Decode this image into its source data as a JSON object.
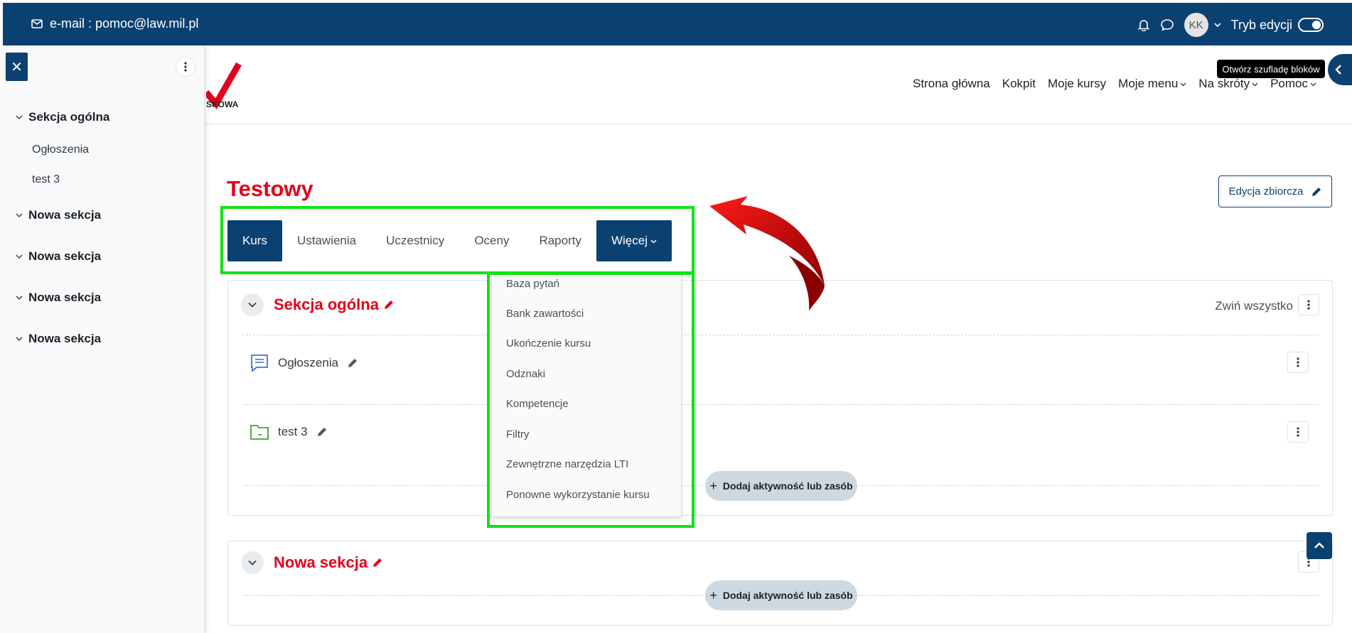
{
  "topbar": {
    "email": "e-mail : pomoc@law.mil.pl",
    "avatar_initials": "KK",
    "edit_mode_label": "Tryb edycji"
  },
  "drawer": {
    "sections": [
      {
        "title": "Sekcja ogólna",
        "items": [
          "Ogłoszenia",
          "test 3"
        ]
      },
      {
        "title": "Nowa sekcja",
        "items": []
      },
      {
        "title": "Nowa sekcja",
        "items": []
      },
      {
        "title": "Nowa sekcja",
        "items": []
      },
      {
        "title": "Nowa sekcja",
        "items": []
      }
    ]
  },
  "logo": {
    "partial_text": "SKOWA"
  },
  "nav": {
    "items": [
      "Strona główna",
      "Kokpit",
      "Moje kursy",
      "Moje menu",
      "Na skróty",
      "Pomoc"
    ]
  },
  "tooltip": "Otwórz szufladę bloków",
  "course": {
    "title": "Testowy",
    "bulk_edit": "Edycja zbiorcza"
  },
  "tabs": [
    "Kurs",
    "Ustawienia",
    "Uczestnicy",
    "Oceny",
    "Raporty",
    "Więcej"
  ],
  "more_menu": [
    "Baza pytań",
    "Bank zawartości",
    "Ukończenie kursu",
    "Odznaki",
    "Kompetencje",
    "Filtry",
    "Zewnętrzne narzędzia LTI",
    "Ponowne wykorzystanie kursu"
  ],
  "sections": {
    "general": {
      "title": "Sekcja ogólna",
      "collapse_all": "Zwiń wszystko",
      "activities": [
        "Ogłoszenia",
        "test 3"
      ],
      "add_label": "Dodaj aktywność lub zasób"
    },
    "new1": {
      "title": "Nowa sekcja",
      "add_label": "Dodaj aktywność lub zasób"
    }
  },
  "colors": {
    "brand_navy": "#0b4170",
    "accent_red": "#e3001b",
    "highlight_green": "#12e312"
  }
}
